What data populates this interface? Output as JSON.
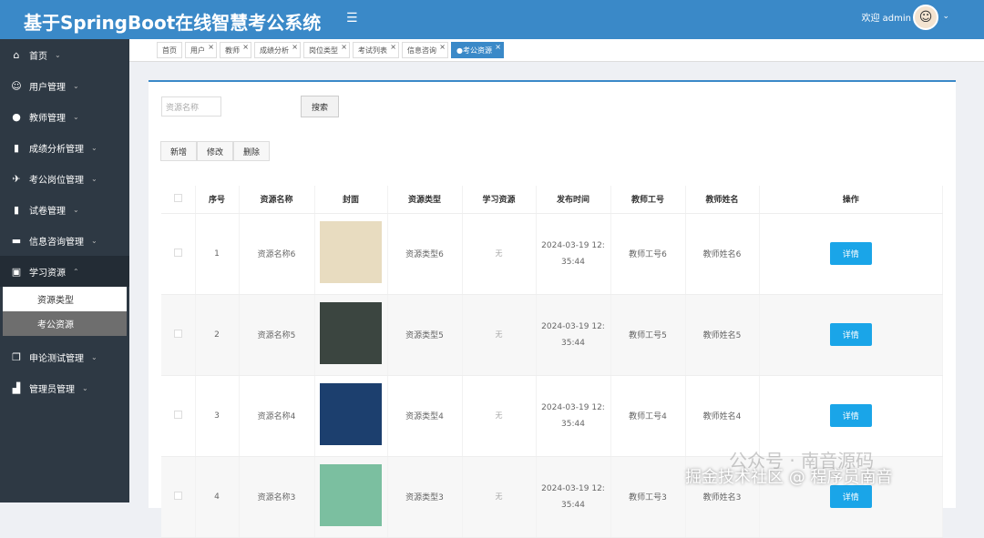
{
  "header": {
    "title": "基于SpringBoot在线智慧考公系统",
    "welcome": "欢迎 admin",
    "menu_icon": "☰"
  },
  "sidebar": {
    "items": [
      {
        "label": "首页",
        "icon": "⌂"
      },
      {
        "label": "用户管理",
        "icon": "☺"
      },
      {
        "label": "教师管理",
        "icon": "●"
      },
      {
        "label": "成绩分析管理",
        "icon": "▮"
      },
      {
        "label": "考公岗位管理",
        "icon": "✈"
      },
      {
        "label": "试卷管理",
        "icon": "▮"
      },
      {
        "label": "信息咨询管理",
        "icon": "▬"
      },
      {
        "label": "学习资源",
        "icon": "▣"
      }
    ],
    "submenu": [
      "资源类型",
      "考公资源"
    ],
    "items_after": [
      {
        "label": "申论测试管理",
        "icon": "❐"
      },
      {
        "label": "管理员管理",
        "icon": "▟"
      }
    ]
  },
  "tabs": [
    "首页",
    "用户",
    "教师",
    "成绩分析",
    "岗位类型",
    "考试列表",
    "信息咨询",
    "●考公资源"
  ],
  "search": {
    "placeholder": "资源名称",
    "button": "搜索"
  },
  "actions": {
    "add": "新增",
    "edit": "修改",
    "delete": "删除"
  },
  "table": {
    "headers": [
      "序号",
      "资源名称",
      "封面",
      "资源类型",
      "学习资源",
      "发布时间",
      "教师工号",
      "教师姓名",
      "操作"
    ],
    "rows": [
      {
        "no": "1",
        "name": "资源名称6",
        "type": "资源类型6",
        "res": "无",
        "time1": "2024-03-19 12:",
        "time2": "35:44",
        "tid": "教师工号6",
        "tname": "教师姓名6",
        "btn": "详情",
        "color": "#e8dcc0"
      },
      {
        "no": "2",
        "name": "资源名称5",
        "type": "资源类型5",
        "res": "无",
        "time1": "2024-03-19 12:",
        "time2": "35:44",
        "tid": "教师工号5",
        "tname": "教师姓名5",
        "btn": "详情",
        "color": "#3b4540"
      },
      {
        "no": "3",
        "name": "资源名称4",
        "type": "资源类型4",
        "res": "无",
        "time1": "2024-03-19 12:",
        "time2": "35:44",
        "tid": "教师工号4",
        "tname": "教师姓名4",
        "btn": "详情",
        "color": "#1c3f6e"
      },
      {
        "no": "4",
        "name": "资源名称3",
        "type": "资源类型3",
        "res": "无",
        "time1": "2024-03-19 12:",
        "time2": "35:44",
        "tid": "教师工号3",
        "tname": "教师姓名3",
        "btn": "详情",
        "color": "#7bbfa0"
      }
    ]
  },
  "watermark": {
    "line1": "公众号 · 南音源码",
    "line2": "掘金技术社区 @ 程序员南音"
  }
}
